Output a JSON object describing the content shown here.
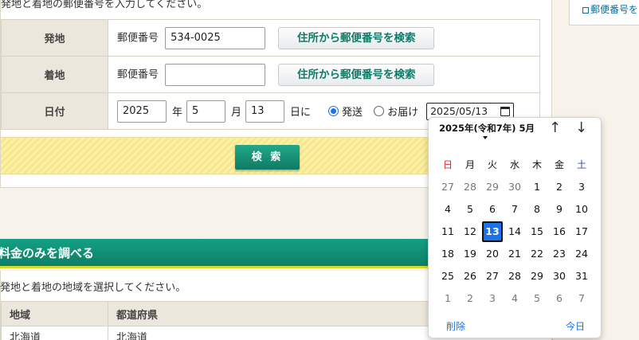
{
  "intro_text": "発地と着地の郵便番号を入力してください。",
  "form": {
    "origin": {
      "label": "発地",
      "zip_label": "郵便番号",
      "zip_value": "534-0025",
      "search_button": "住所から郵便番号を検索"
    },
    "destination": {
      "label": "着地",
      "zip_label": "郵便番号",
      "zip_value": "",
      "search_button": "住所から郵便番号を検索"
    },
    "date": {
      "label": "日付",
      "year": "2025",
      "year_unit": "年",
      "month": "5",
      "month_unit": "月",
      "day": "13",
      "day_unit": "日に",
      "radio_send": "発送",
      "radio_deliver": "お届け",
      "selected_radio": "send",
      "date_input_value": "2025/05/13"
    },
    "submit_label": "検 索"
  },
  "side": {
    "link_text": "郵便番号を"
  },
  "section": {
    "title": "料金のみを調べる",
    "text": "発地と着地の地域を選択してください。",
    "headers": [
      "地域",
      "都道府県"
    ],
    "first_row": [
      "北海道",
      "北海道"
    ]
  },
  "calendar": {
    "heading": "2025年(令和7年) 5月",
    "nav_up": "↑",
    "nav_down": "↓",
    "weekdays": [
      "日",
      "月",
      "火",
      "水",
      "木",
      "金",
      "土"
    ],
    "weeks": [
      [
        "27",
        "28",
        "29",
        "30",
        "1",
        "2",
        "3"
      ],
      [
        "4",
        "5",
        "6",
        "7",
        "8",
        "9",
        "10"
      ],
      [
        "11",
        "12",
        "13",
        "14",
        "15",
        "16",
        "17"
      ],
      [
        "18",
        "19",
        "20",
        "21",
        "22",
        "23",
        "24"
      ],
      [
        "25",
        "26",
        "27",
        "28",
        "29",
        "30",
        "31"
      ],
      [
        "1",
        "2",
        "3",
        "4",
        "5",
        "6",
        "7"
      ]
    ],
    "selected_day": "13",
    "clear_label": "削除",
    "today_label": "今日",
    "colors": {
      "selected": "#1a73e8",
      "sunday": "#d32f2f",
      "saturday": "#3949ab"
    }
  }
}
